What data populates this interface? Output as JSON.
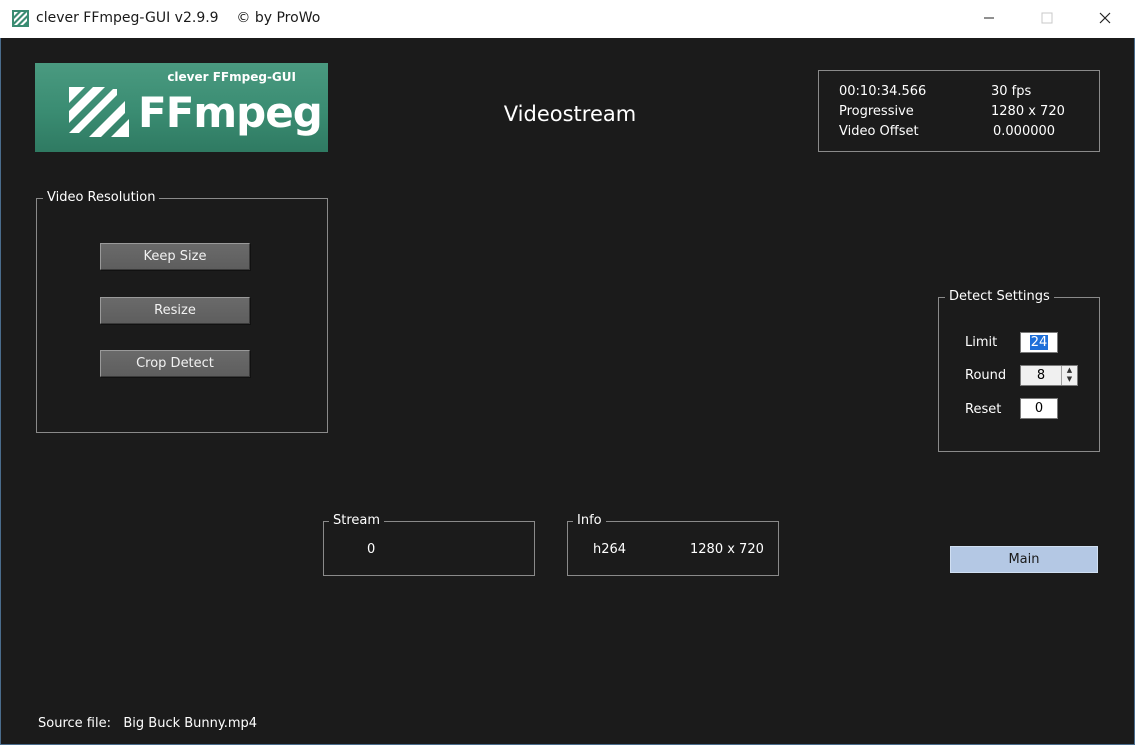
{
  "window": {
    "title": "clever FFmpeg-GUI v2.9.9",
    "copyright": "© by ProWo"
  },
  "logo": {
    "subtitle": "clever FFmpeg-GUI",
    "brand": "FFmpeg"
  },
  "heading": "Videostream",
  "stream_info": {
    "duration": "00:10:34.566",
    "fps": "30 fps",
    "scan_type": "Progressive",
    "resolution": "1280 x 720",
    "offset_label": "Video Offset",
    "offset_value": "0.000000"
  },
  "video_resolution": {
    "title": "Video Resolution",
    "buttons": [
      "Keep Size",
      "Resize",
      "Crop Detect"
    ]
  },
  "detect_settings": {
    "title": "Detect Settings",
    "limit_label": "Limit",
    "limit_value": "24",
    "round_label": "Round",
    "round_value": "8",
    "reset_label": "Reset",
    "reset_value": "0"
  },
  "stream_group": {
    "title": "Stream",
    "value": "0"
  },
  "info_group": {
    "title": "Info",
    "codec": "h264",
    "resolution": "1280 x 720"
  },
  "main_button": "Main",
  "footer": {
    "label": "Source file:",
    "filename": "Big Buck Bunny.mp4"
  },
  "colors": {
    "background": "#1b1b1b",
    "logo_green": "#3a8c72",
    "main_button": "#b4c8e4",
    "selection": "#1e6fd9"
  },
  "icons": [
    "ffmpeg-app-icon",
    "minimize-icon",
    "maximize-icon",
    "close-icon",
    "spin-up-icon",
    "spin-down-icon"
  ]
}
